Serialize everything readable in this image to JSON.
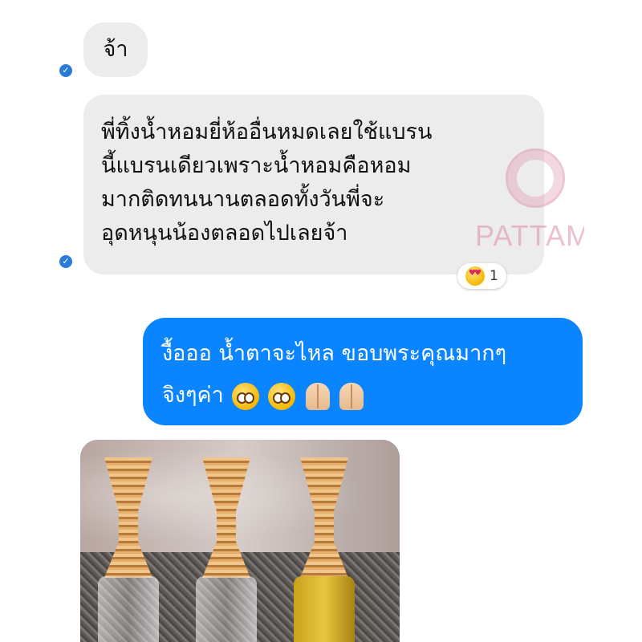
{
  "messages": [
    {
      "id": "m1",
      "direction": "incoming",
      "text": "จ้า"
    },
    {
      "id": "m2",
      "direction": "incoming",
      "lines": [
        "พี่ทิ้งน้ำหอมยี่ห้ออื่นหมดเลยใช้แบรน",
        "นี้แบรนเดียวเพราะน้ำหอมคือหอม",
        "มากติดทนนานตลอดทั้งวันพี่จะ",
        "อุดหนุนน้องตลอดไปเลยจ้า"
      ],
      "reaction": {
        "emoji": "heart-eyes-emoji",
        "count": "1"
      }
    },
    {
      "id": "m3",
      "direction": "outgoing",
      "lines": [
        "งื้อออ น้ำตาจะไหล ขอบพระคุณมากๆ",
        "จิงๆค่า"
      ]
    }
  ],
  "watermark": {
    "text": "PATTAMA"
  },
  "colors": {
    "outgoing": "#0a84ff",
    "incoming": "#ececec",
    "seen": "#2a7bd6"
  },
  "attachment": {
    "kind": "photo"
  }
}
